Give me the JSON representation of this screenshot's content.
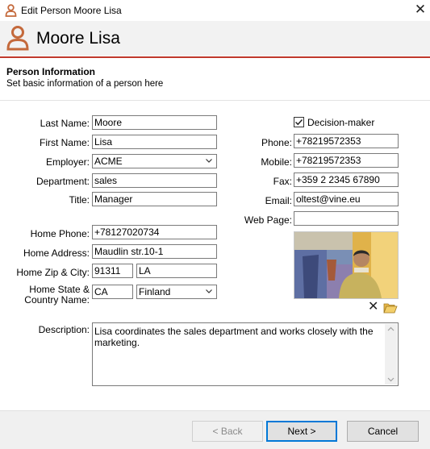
{
  "window": {
    "title": "Edit Person Moore Lisa",
    "close_icon": "close-icon"
  },
  "header": {
    "name": "Moore Lisa",
    "icon": "person-icon"
  },
  "section": {
    "title": "Person Information",
    "subtitle": "Set basic information of a person here"
  },
  "left": {
    "last_name": {
      "label": "Last Name:",
      "value": "Moore"
    },
    "first_name": {
      "label": "First Name:",
      "value": "Lisa"
    },
    "employer": {
      "label": "Employer:",
      "value": "ACME"
    },
    "department": {
      "label": "Department:",
      "value": "sales"
    },
    "title": {
      "label": "Title:",
      "value": "Manager"
    },
    "home_phone": {
      "label": "Home Phone:",
      "value": "+78127020734"
    },
    "home_address": {
      "label": "Home Address:",
      "value": "Maudlin str.10-1"
    },
    "home_zip_city": {
      "label": "Home Zip & City:",
      "zip": "91311",
      "city": "LA"
    },
    "home_state_country": {
      "label_line1": "Home State &",
      "label_line2": "Country Name:",
      "state": "CA",
      "country": "Finland"
    }
  },
  "right": {
    "decision_maker": {
      "label": "Decision-maker",
      "checked": true
    },
    "phone": {
      "label": "Phone:",
      "value": "+78219572353"
    },
    "mobile": {
      "label": "Mobile:",
      "value": "+78219572353"
    },
    "fax": {
      "label": "Fax:",
      "value": "+359 2 2345 67890"
    },
    "email": {
      "label": "Email:",
      "value": "oltest@vine.eu"
    },
    "web_page": {
      "label": "Web Page:",
      "value": ""
    }
  },
  "photo": {
    "remove_icon": "close-icon",
    "open_icon": "folder-open-icon"
  },
  "description": {
    "label": "Description:",
    "value": "Lisa coordinates the sales department and works closely with the marketing."
  },
  "buttons": {
    "back": "< Back",
    "next": "Next >",
    "cancel": "Cancel"
  },
  "colors": {
    "accent": "#c0392b",
    "person_icon": "#c4693b",
    "focus_border": "#0078d7"
  }
}
